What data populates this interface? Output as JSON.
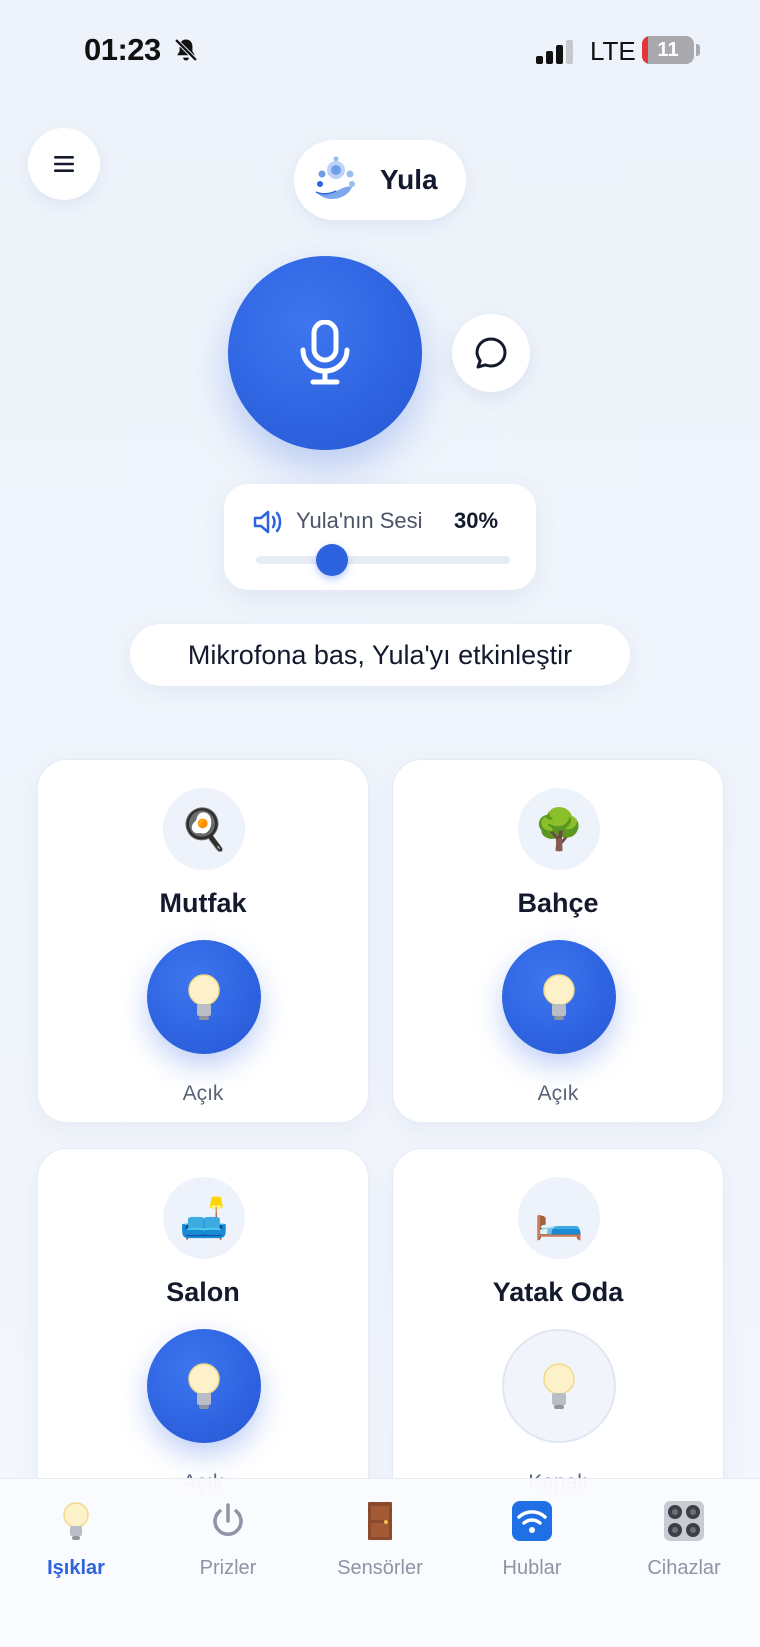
{
  "status_bar": {
    "time": "01:23",
    "network": "LTE",
    "battery": "11",
    "battery_level_percent": 11
  },
  "assistant": {
    "name": "Yula"
  },
  "volume": {
    "label": "Yula'nın Sesi",
    "value_text": "30%",
    "value_percent": 30
  },
  "hint": "Mikrofona bas, Yula'yı etkinleştir",
  "rooms": [
    {
      "name": "Mutfak",
      "emoji": "🍳",
      "status": "Açık",
      "light_on": true
    },
    {
      "name": "Bahçe",
      "emoji": "🌳",
      "status": "Açık",
      "light_on": true
    },
    {
      "name": "Salon",
      "emoji": "🛋️",
      "status": "Açık",
      "light_on": true
    },
    {
      "name": "Yatak Oda",
      "emoji": "🛏️",
      "status": "Kapalı",
      "light_on": false
    }
  ],
  "tabs": [
    {
      "label": "Işıklar",
      "icon": "lightbulb-icon",
      "active": true
    },
    {
      "label": "Prizler",
      "icon": "power-icon",
      "active": false
    },
    {
      "label": "Sensörler",
      "icon": "door-icon",
      "active": false
    },
    {
      "label": "Hublar",
      "icon": "wifi-icon",
      "active": false
    },
    {
      "label": "Cihazlar",
      "icon": "stove-icon",
      "active": false
    }
  ],
  "colors": {
    "accent": "#2e63e0",
    "background": "#eef3fb",
    "battery_low": "#e5343a"
  }
}
